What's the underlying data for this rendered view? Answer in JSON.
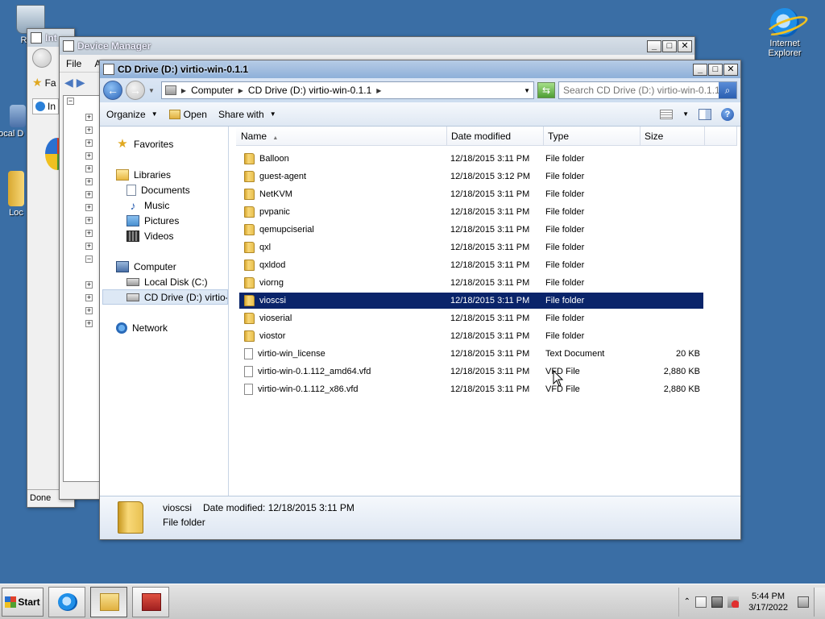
{
  "desktop": {
    "icons": [
      {
        "label": "Recy"
      },
      {
        "label": "Internet Explorer"
      },
      {
        "label": "Local D Sho"
      },
      {
        "label": "Loc"
      }
    ]
  },
  "ie_window": {
    "title": "Int",
    "status": "Done",
    "addr_fragment": "Fa",
    "tab_fragment": "In"
  },
  "device_manager": {
    "title": "Device Manager",
    "menu": [
      "File",
      "A"
    ]
  },
  "explorer": {
    "title": "CD Drive (D:) virtio-win-0.1.1",
    "address": {
      "segments": [
        "Computer",
        "CD Drive (D:) virtio-win-0.1.1"
      ]
    },
    "search": {
      "placeholder": "Search CD Drive (D:) virtio-win-0.1.1"
    },
    "toolbar": {
      "organize": "Organize",
      "open": "Open",
      "share_with": "Share with"
    },
    "nav": {
      "favorites": "Favorites",
      "libraries": "Libraries",
      "documents": "Documents",
      "music": "Music",
      "pictures": "Pictures",
      "videos": "Videos",
      "computer": "Computer",
      "local_disk": "Local Disk (C:)",
      "cd_drive": "CD Drive (D:) virtio-win",
      "network": "Network"
    },
    "columns": {
      "name": "Name",
      "date": "Date modified",
      "type": "Type",
      "size": "Size"
    },
    "files": [
      {
        "name": "Balloon",
        "date": "12/18/2015 3:11 PM",
        "type": "File folder",
        "size": "",
        "kind": "folder"
      },
      {
        "name": "guest-agent",
        "date": "12/18/2015 3:12 PM",
        "type": "File folder",
        "size": "",
        "kind": "folder"
      },
      {
        "name": "NetKVM",
        "date": "12/18/2015 3:11 PM",
        "type": "File folder",
        "size": "",
        "kind": "folder"
      },
      {
        "name": "pvpanic",
        "date": "12/18/2015 3:11 PM",
        "type": "File folder",
        "size": "",
        "kind": "folder"
      },
      {
        "name": "qemupciserial",
        "date": "12/18/2015 3:11 PM",
        "type": "File folder",
        "size": "",
        "kind": "folder"
      },
      {
        "name": "qxl",
        "date": "12/18/2015 3:11 PM",
        "type": "File folder",
        "size": "",
        "kind": "folder"
      },
      {
        "name": "qxldod",
        "date": "12/18/2015 3:11 PM",
        "type": "File folder",
        "size": "",
        "kind": "folder"
      },
      {
        "name": "viorng",
        "date": "12/18/2015 3:11 PM",
        "type": "File folder",
        "size": "",
        "kind": "folder"
      },
      {
        "name": "vioscsi",
        "date": "12/18/2015 3:11 PM",
        "type": "File folder",
        "size": "",
        "kind": "folder"
      },
      {
        "name": "vioserial",
        "date": "12/18/2015 3:11 PM",
        "type": "File folder",
        "size": "",
        "kind": "folder"
      },
      {
        "name": "viostor",
        "date": "12/18/2015 3:11 PM",
        "type": "File folder",
        "size": "",
        "kind": "folder"
      },
      {
        "name": "virtio-win_license",
        "date": "12/18/2015 3:11 PM",
        "type": "Text Document",
        "size": "20 KB",
        "kind": "file"
      },
      {
        "name": "virtio-win-0.1.112_amd64.vfd",
        "date": "12/18/2015 3:11 PM",
        "type": "VFD File",
        "size": "2,880 KB",
        "kind": "file"
      },
      {
        "name": "virtio-win-0.1.112_x86.vfd",
        "date": "12/18/2015 3:11 PM",
        "type": "VFD File",
        "size": "2,880 KB",
        "kind": "file"
      }
    ],
    "selected_index": 8,
    "details": {
      "name": "vioscsi",
      "date_label": "Date modified:  12/18/2015 3:11 PM",
      "type": "File folder"
    }
  },
  "taskbar": {
    "start": "Start",
    "time": "5:44 PM",
    "date": "3/17/2022"
  },
  "colors": {
    "desktop": "#3a6ea5",
    "selection": "#0a246a"
  }
}
